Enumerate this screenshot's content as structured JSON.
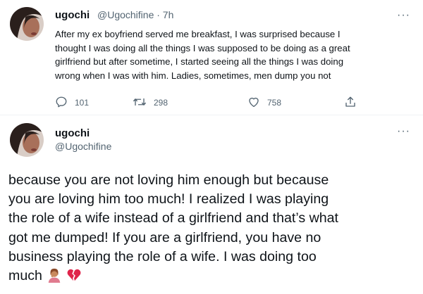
{
  "tweet1": {
    "name": "ugochi",
    "handle_time": "@Ugochifine · 7h",
    "lines": [
      "After my ex boyfriend served me breakfast, I was surprised because I",
      "thought I was doing all the things I was supposed to be doing as a great",
      "girlfriend but after sometime, I started seeing all the things I was doing",
      "wrong when I was with him. Ladies, sometimes, men dump you not"
    ],
    "replies": "101",
    "retweets": "298",
    "likes": "758",
    "more": "···"
  },
  "tweet2": {
    "name": "ugochi",
    "handle": "@Ugochifine",
    "more": "···",
    "lines": [
      "because you are not loving him enough  but because",
      "you are loving him too much! I realized  I was playing",
      "the role of a wife instead of a girlfriend and that’s what",
      "got me dumped! If you are a girlfriend, you have no",
      "business playing the role of a wife. I was doing too",
      "much"
    ],
    "emojis": [
      "person-facepalming-emoji",
      "broken-heart-emoji"
    ]
  },
  "colors": {
    "text": "#0f1419",
    "secondary": "#536471",
    "divider": "#eff3f4"
  }
}
